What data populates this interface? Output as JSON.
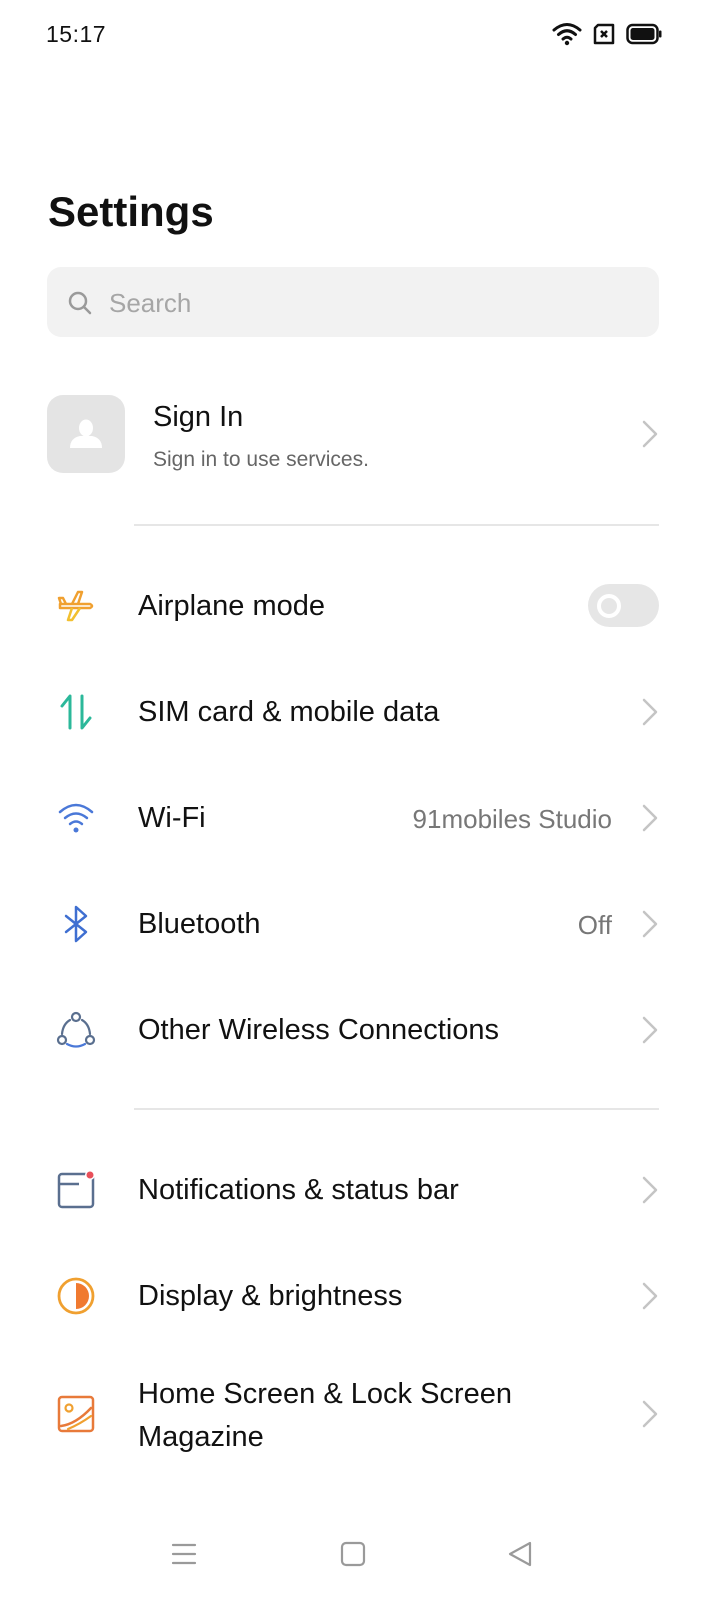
{
  "status_bar": {
    "time": "15:17",
    "icons": [
      "wifi-icon",
      "sim-error-icon",
      "battery-icon"
    ]
  },
  "page": {
    "title": "Settings"
  },
  "search": {
    "placeholder": "Search",
    "value": ""
  },
  "account": {
    "title": "Sign In",
    "subtitle": "Sign in to use services."
  },
  "connectivity": [
    {
      "icon": "airplane-icon",
      "label": "Airplane mode",
      "control": "toggle",
      "enabled": false
    },
    {
      "icon": "mobile-data-icon",
      "label": "SIM card & mobile data",
      "value": ""
    },
    {
      "icon": "wifi-icon",
      "label": "Wi-Fi",
      "value": "91mobiles Studio"
    },
    {
      "icon": "bluetooth-icon",
      "label": "Bluetooth",
      "value": "Off"
    },
    {
      "icon": "connections-icon",
      "label": "Other Wireless Connections",
      "value": ""
    }
  ],
  "display": [
    {
      "icon": "notification-icon",
      "label": "Notifications & status bar"
    },
    {
      "icon": "brightness-icon",
      "label": "Display & brightness"
    },
    {
      "icon": "wallpaper-icon",
      "label": "Home Screen & Lock Screen\nMagazine"
    }
  ],
  "colors": {
    "airplane": "#f0a030",
    "mobile_data": "#2bb89a",
    "wifi": "#4a78d8",
    "bluetooth": "#3f6fd1",
    "connections": "#5a6f8f",
    "notification_dot": "#e8505a",
    "brightness": "#f08a30",
    "wallpaper": "#e87a3a"
  }
}
